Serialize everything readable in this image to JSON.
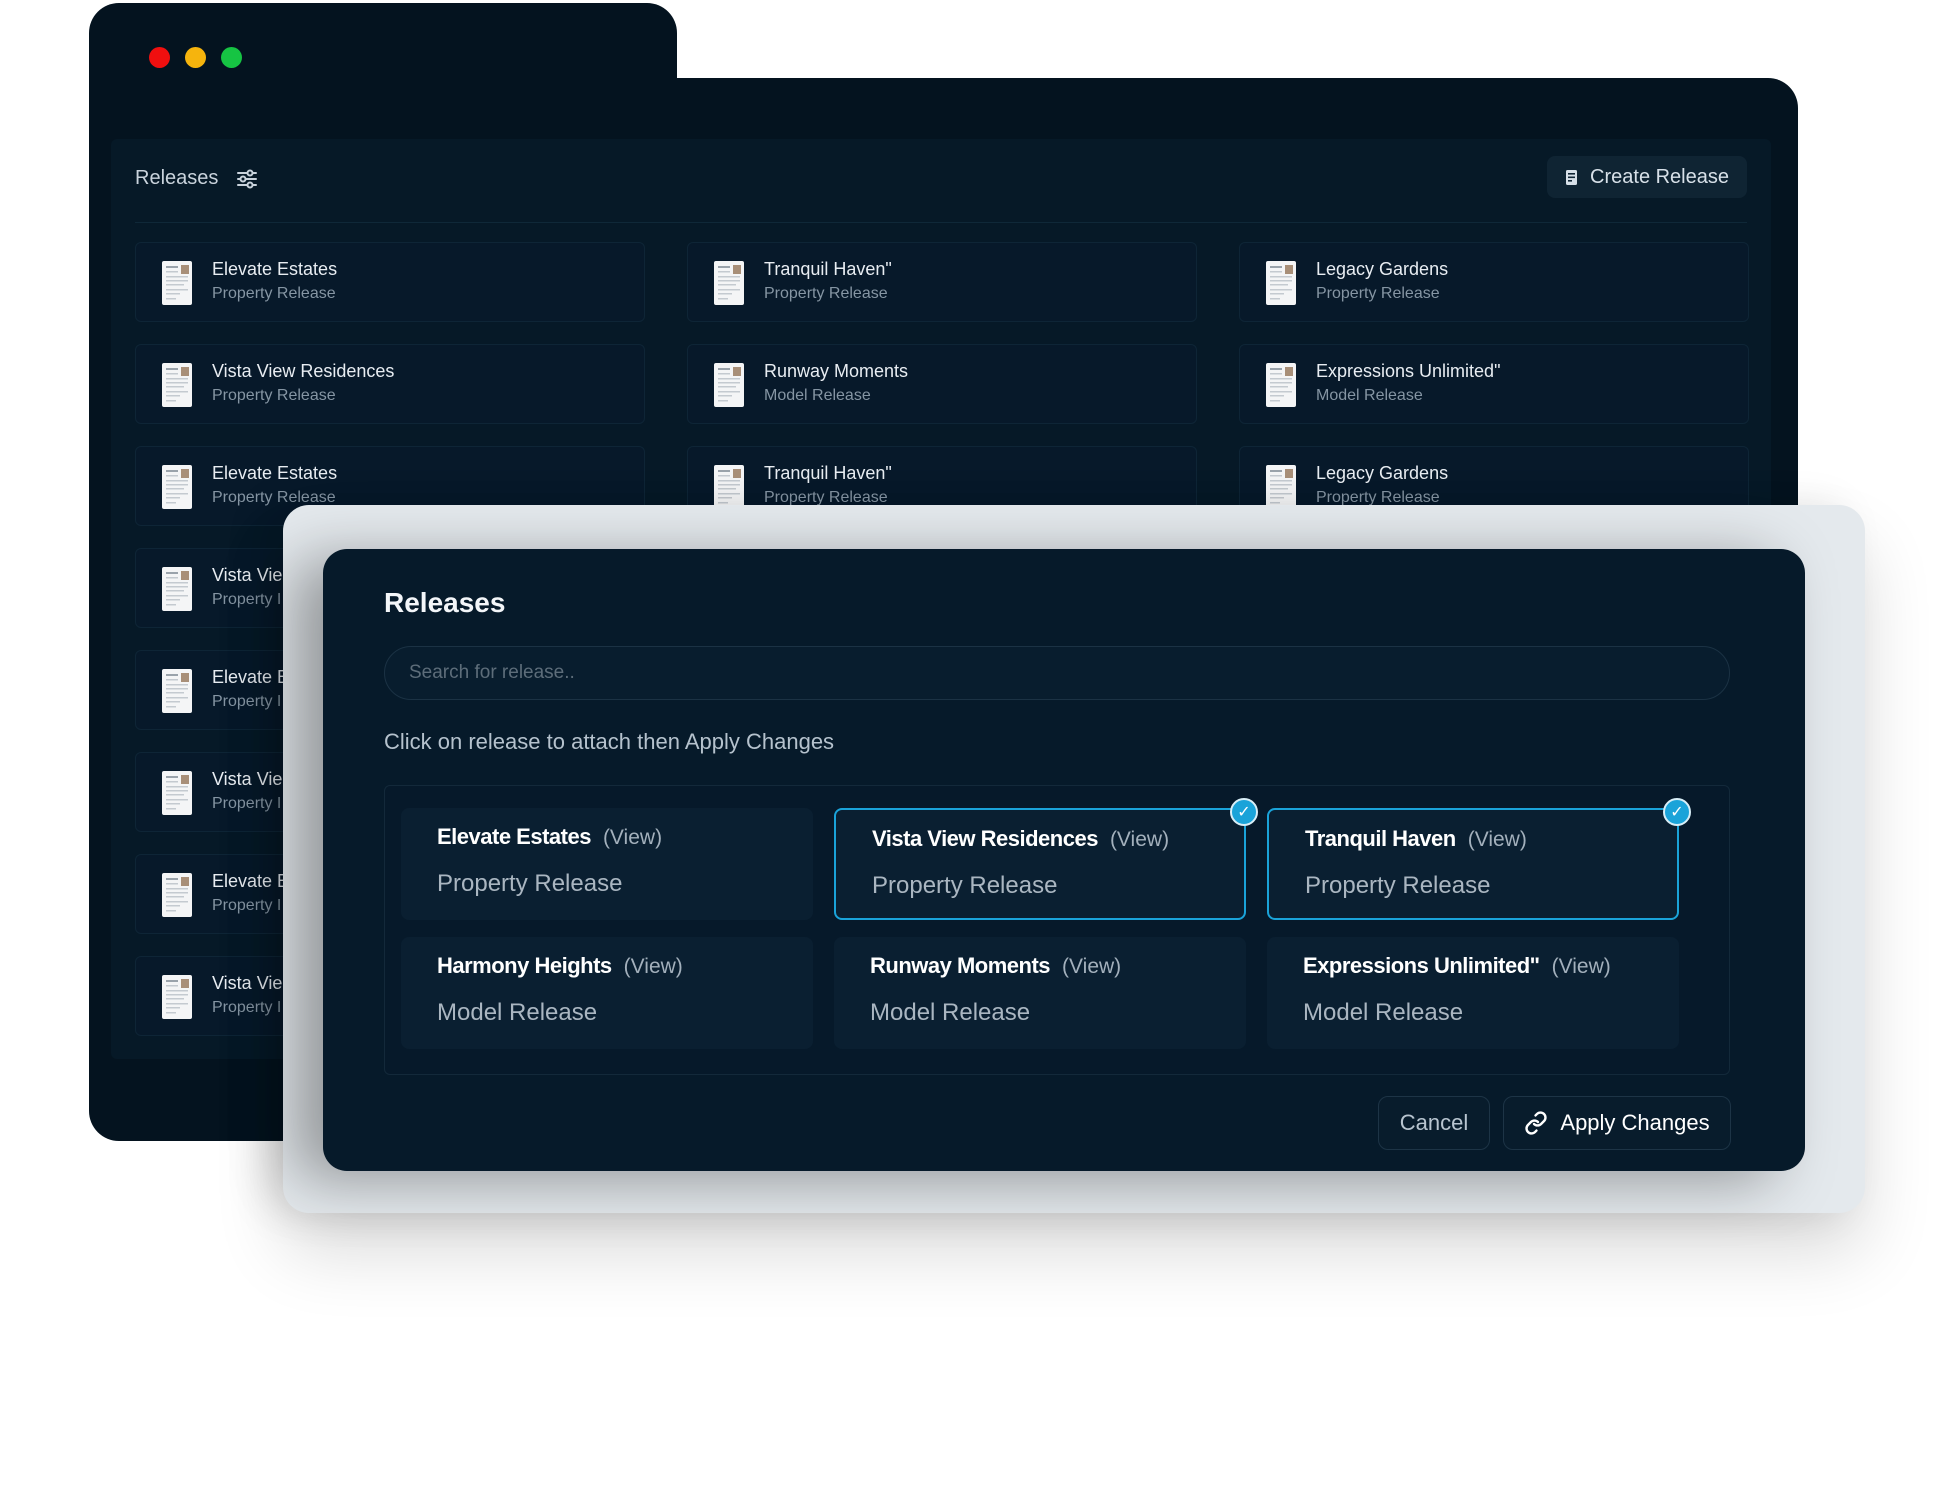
{
  "window": {
    "traffic_lights": [
      "red",
      "yellow",
      "green"
    ],
    "colors": {
      "red": "#f00f0f",
      "yellow": "#f6b40d",
      "green": "#16c443",
      "accent": "#1aa3d9"
    }
  },
  "background_panel": {
    "title": "Releases",
    "filter_icon": "sliders-icon",
    "create_button": {
      "label": "Create Release",
      "icon": "document-icon"
    },
    "cards": [
      {
        "name": "Elevate Estates",
        "type": "Property Release"
      },
      {
        "name": "Tranquil Haven\"",
        "type": "Property Release"
      },
      {
        "name": "Legacy Gardens",
        "type": "Property Release"
      },
      {
        "name": "Vista View Residences",
        "type": "Property Release"
      },
      {
        "name": "Runway Moments",
        "type": "Model Release"
      },
      {
        "name": "Expressions Unlimited\"",
        "type": "Model Release"
      },
      {
        "name": "Elevate Estates",
        "type": "Property Release"
      },
      {
        "name": "Tranquil Haven\"",
        "type": "Property Release"
      },
      {
        "name": "Legacy Gardens",
        "type": "Property Release"
      },
      {
        "name": "Vista Vie",
        "type": "Property I"
      },
      {
        "name": "Elevate E",
        "type": "Property I"
      },
      {
        "name": "Vista Vie",
        "type": "Property I"
      },
      {
        "name": "Elevate E",
        "type": "Property I"
      },
      {
        "name": "Vista Vie",
        "type": "Property I"
      }
    ]
  },
  "modal": {
    "title": "Releases",
    "search": {
      "placeholder": "Search for release..",
      "value": ""
    },
    "instruction": "Click on release to attach then Apply Changes",
    "options": [
      {
        "name": "Elevate Estates",
        "view_label": "(View)",
        "type": "Property Release",
        "selected": false
      },
      {
        "name": "Vista View Residences",
        "view_label": "(View)",
        "type": "Property Release",
        "selected": true
      },
      {
        "name": "Tranquil Haven",
        "view_label": "(View)",
        "type": "Property Release",
        "selected": true
      },
      {
        "name": "Harmony Heights",
        "view_label": "(View)",
        "type": "Model Release",
        "selected": false
      },
      {
        "name": "Runway Moments",
        "view_label": "(View)",
        "type": "Model Release",
        "selected": false
      },
      {
        "name": "Expressions Unlimited\"",
        "view_label": "(View)",
        "type": "Model Release",
        "selected": false
      }
    ],
    "check_mark": "✓",
    "cancel_label": "Cancel",
    "apply_label": "Apply Changes",
    "apply_icon": "link-icon"
  }
}
